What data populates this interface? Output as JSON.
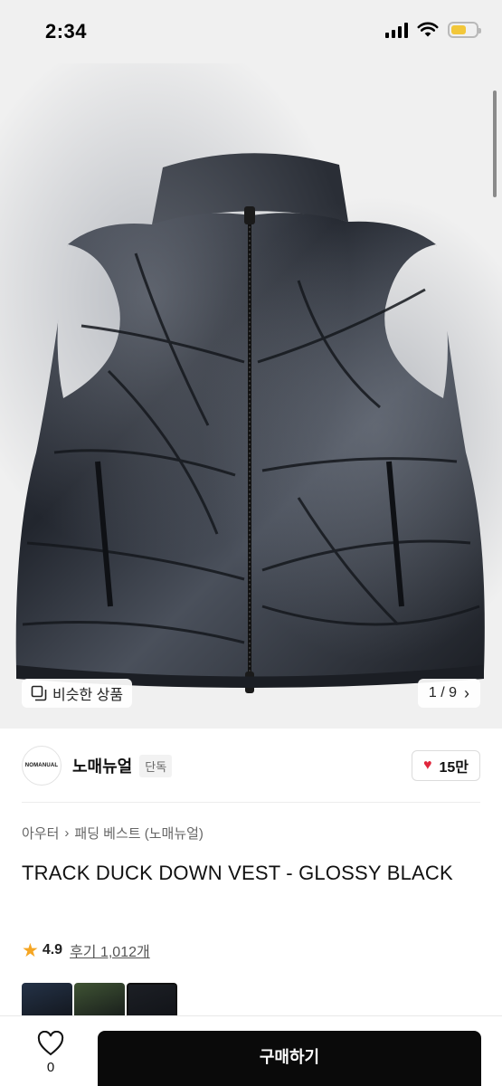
{
  "status_bar": {
    "time": "2:34",
    "battery_color": "#f2c73a"
  },
  "gallery": {
    "similar_label": "비슷한 상품",
    "pager_label": "1 / 9",
    "image_icon": "black-puffer-vest-image"
  },
  "brand": {
    "logo_text": "NOMANUAL",
    "name": "노매뉴얼",
    "badge": "단독",
    "likes": "15만"
  },
  "breadcrumb": {
    "category": "아우터",
    "subcategory": "패딩 베스트 (노매뉴얼)"
  },
  "product": {
    "title": "TRACK DUCK DOWN VEST - GLOSSY BLACK",
    "rating": "4.9",
    "reviews_label": "후기 1,012개"
  },
  "color_options": [
    {
      "name": "navy",
      "color": "#243247"
    },
    {
      "name": "olive",
      "color": "#3f5334"
    },
    {
      "name": "glossy-black",
      "color": "#1c1f25"
    }
  ],
  "bottom_bar": {
    "wish_count": "0",
    "buy_label": "구매하기"
  }
}
